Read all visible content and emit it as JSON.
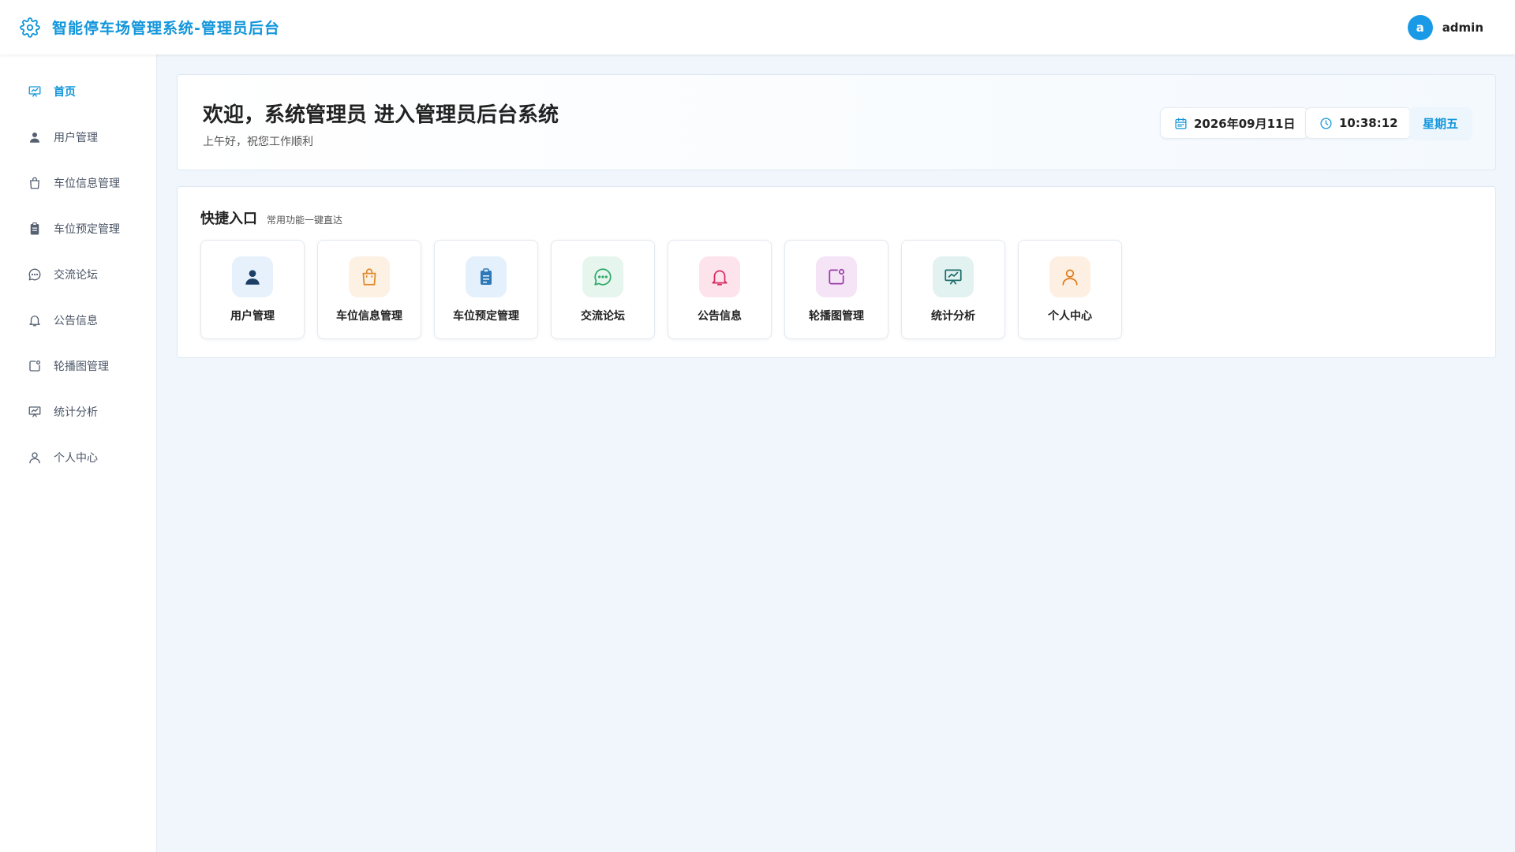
{
  "app": {
    "title": "智能停车场管理系统-管理员后台",
    "brand_icon": "gear-icon",
    "accent_color": "#1296db"
  },
  "user": {
    "avatar_letter": "a",
    "name": "admin"
  },
  "sidebar": {
    "items": [
      {
        "label": "首页",
        "icon": "presentation-chart-icon",
        "active": true
      },
      {
        "label": "用户管理",
        "icon": "user-filled-icon"
      },
      {
        "label": "车位信息管理",
        "icon": "shopping-bag-icon"
      },
      {
        "label": "车位预定管理",
        "icon": "clipboard-icon"
      },
      {
        "label": "交流论坛",
        "icon": "chat-bubble-icon"
      },
      {
        "label": "公告信息",
        "icon": "bell-icon"
      },
      {
        "label": "轮播图管理",
        "icon": "image-badge-icon"
      },
      {
        "label": "统计分析",
        "icon": "presentation-chart-icon"
      },
      {
        "label": "个人中心",
        "icon": "user-outline-icon"
      }
    ]
  },
  "welcome": {
    "title": "欢迎，系统管理员 进入管理员后台系统",
    "subtitle": "上午好，祝您工作顺利",
    "date": "2026年09月11日",
    "time": "10:38:12",
    "weekday": "星期五"
  },
  "quick": {
    "title": "快捷入口",
    "subtitle": "常用功能一键直达",
    "cards": [
      {
        "label": "用户管理",
        "icon": "user-filled-icon",
        "bg": "#e6f1fb",
        "color": "#1d3f66"
      },
      {
        "label": "车位信息管理",
        "icon": "shopping-bag-icon",
        "bg": "#fdf1e4",
        "color": "#e08a2e"
      },
      {
        "label": "车位预定管理",
        "icon": "clipboard-icon",
        "bg": "#e4f0fb",
        "color": "#2f78b8"
      },
      {
        "label": "交流论坛",
        "icon": "chat-bubble-icon",
        "bg": "#e6f6ee",
        "color": "#2fa86a"
      },
      {
        "label": "公告信息",
        "icon": "bell-icon",
        "bg": "#fde4ec",
        "color": "#d8275e"
      },
      {
        "label": "轮播图管理",
        "icon": "image-badge-icon",
        "bg": "#f4e4f6",
        "color": "#9b3aa6"
      },
      {
        "label": "统计分析",
        "icon": "presentation-chart-icon",
        "bg": "#e2f2f1",
        "color": "#1f6d6a"
      },
      {
        "label": "个人中心",
        "icon": "user-outline-icon",
        "bg": "#fdf0e2",
        "color": "#e07b1a"
      }
    ]
  }
}
